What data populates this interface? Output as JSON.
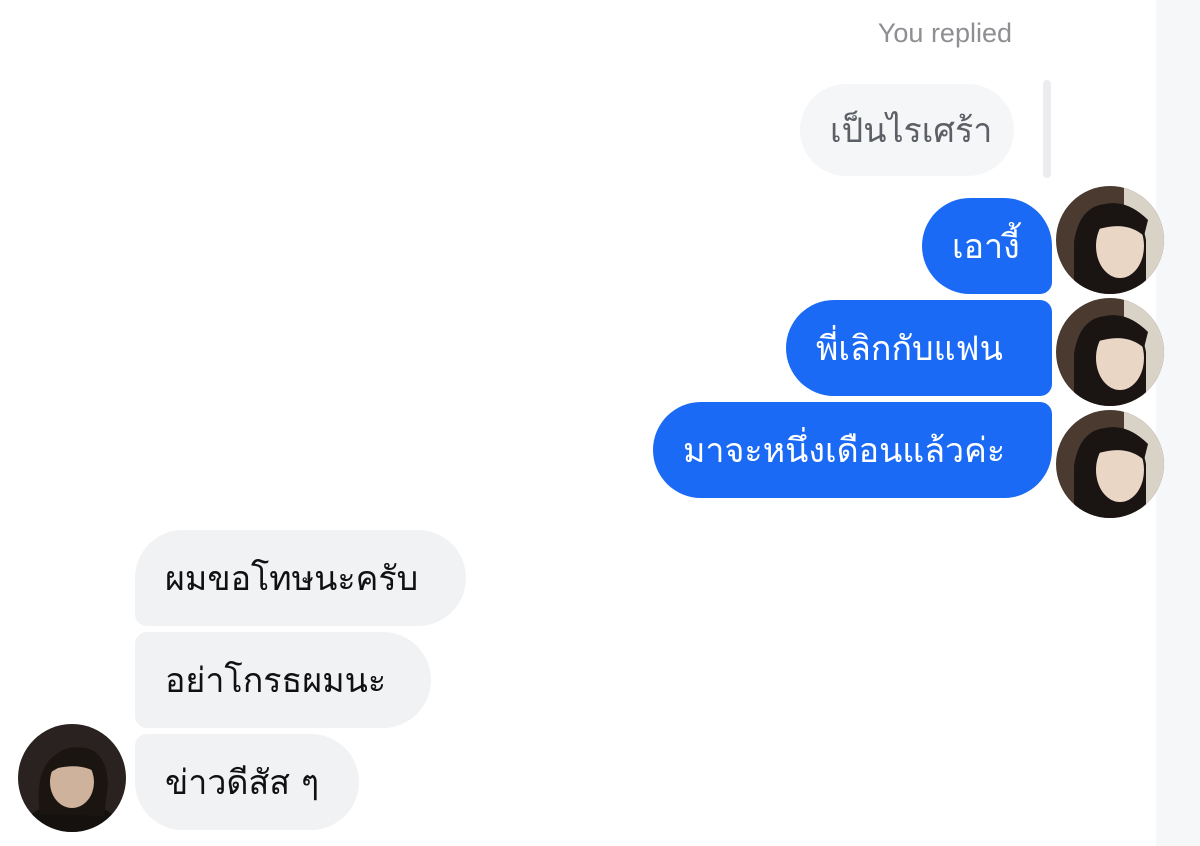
{
  "thread": {
    "reply_label": "You replied",
    "quoted_message": "เป็นไรเศร้า",
    "outgoing": [
      "เอางี้",
      "พี่เลิกกับแฟน",
      "มาจะหนึ่งเดือนแล้วค่ะ"
    ],
    "incoming": [
      "ผมขอโทษนะครับ",
      "อย่าโกรธผมนะ",
      "ข่าวดีสัส ๆ"
    ]
  },
  "colors": {
    "outgoing_bubble": "#1a6af5",
    "incoming_bubble": "#f1f2f4",
    "quoted_bubble": "#f5f6f8",
    "reply_label": "#8e8e93"
  },
  "icons": {
    "outgoing_avatar": "user-avatar-photo",
    "incoming_avatar": "contact-avatar-photo"
  }
}
